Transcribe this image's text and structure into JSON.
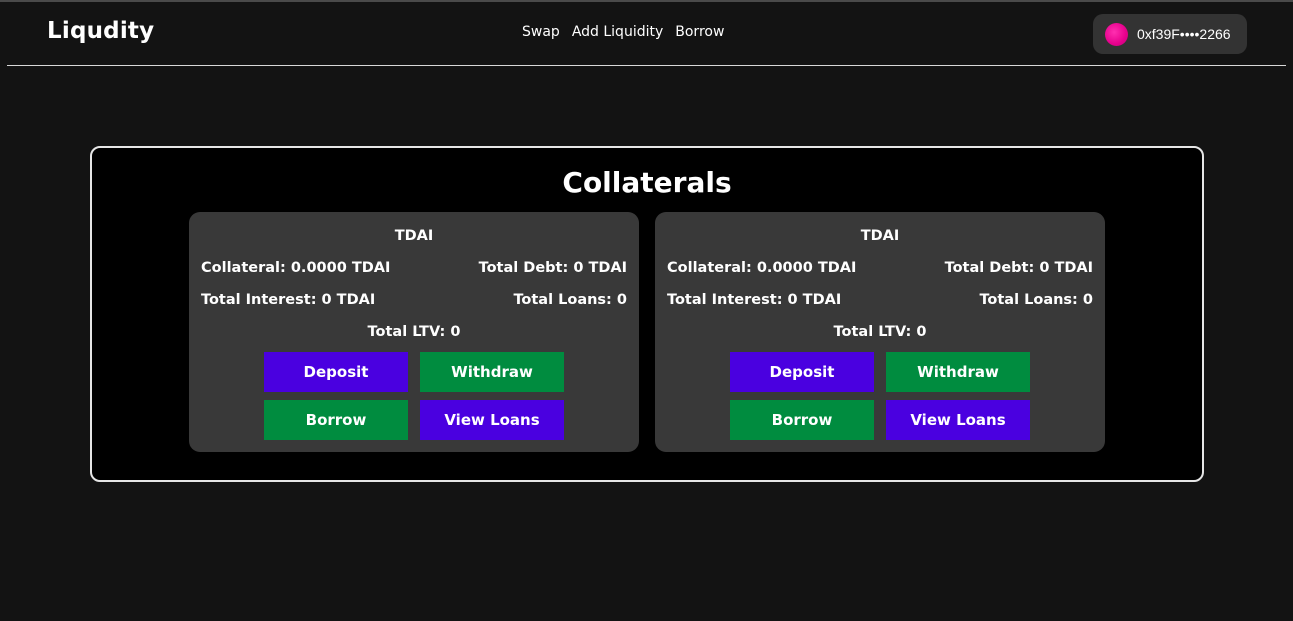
{
  "header": {
    "logo": "Liqudity",
    "nav": [
      "Swap",
      "Add Liquidity",
      "Borrow"
    ],
    "wallet_address": "0xf39F••••2266"
  },
  "main": {
    "title": "Collaterals",
    "cards": [
      {
        "token": "TDAI",
        "collateral": "Collateral: 0.0000 TDAI",
        "total_debt": "Total Debt: 0 TDAI",
        "total_interest": "Total Interest: 0 TDAI",
        "total_loans": "Total Loans: 0",
        "total_ltv": "Total LTV: 0",
        "buttons": {
          "deposit": "Deposit",
          "withdraw": "Withdraw",
          "borrow": "Borrow",
          "view_loans": "View Loans"
        }
      },
      {
        "token": "TDAI",
        "collateral": "Collateral: 0.0000 TDAI",
        "total_debt": "Total Debt: 0 TDAI",
        "total_interest": "Total Interest: 0 TDAI",
        "total_loans": "Total Loans: 0",
        "total_ltv": "Total LTV: 0",
        "buttons": {
          "deposit": "Deposit",
          "withdraw": "Withdraw",
          "borrow": "Borrow",
          "view_loans": "View Loans"
        }
      }
    ]
  },
  "colors": {
    "background": "#131313",
    "card": "#393939",
    "panel": "#000000",
    "button_purple": "#4a00e0",
    "button_green": "#008c3f",
    "wallet_avatar": "#e6008c"
  },
  "icons": {
    "wallet_avatar": "avatar-icon"
  }
}
